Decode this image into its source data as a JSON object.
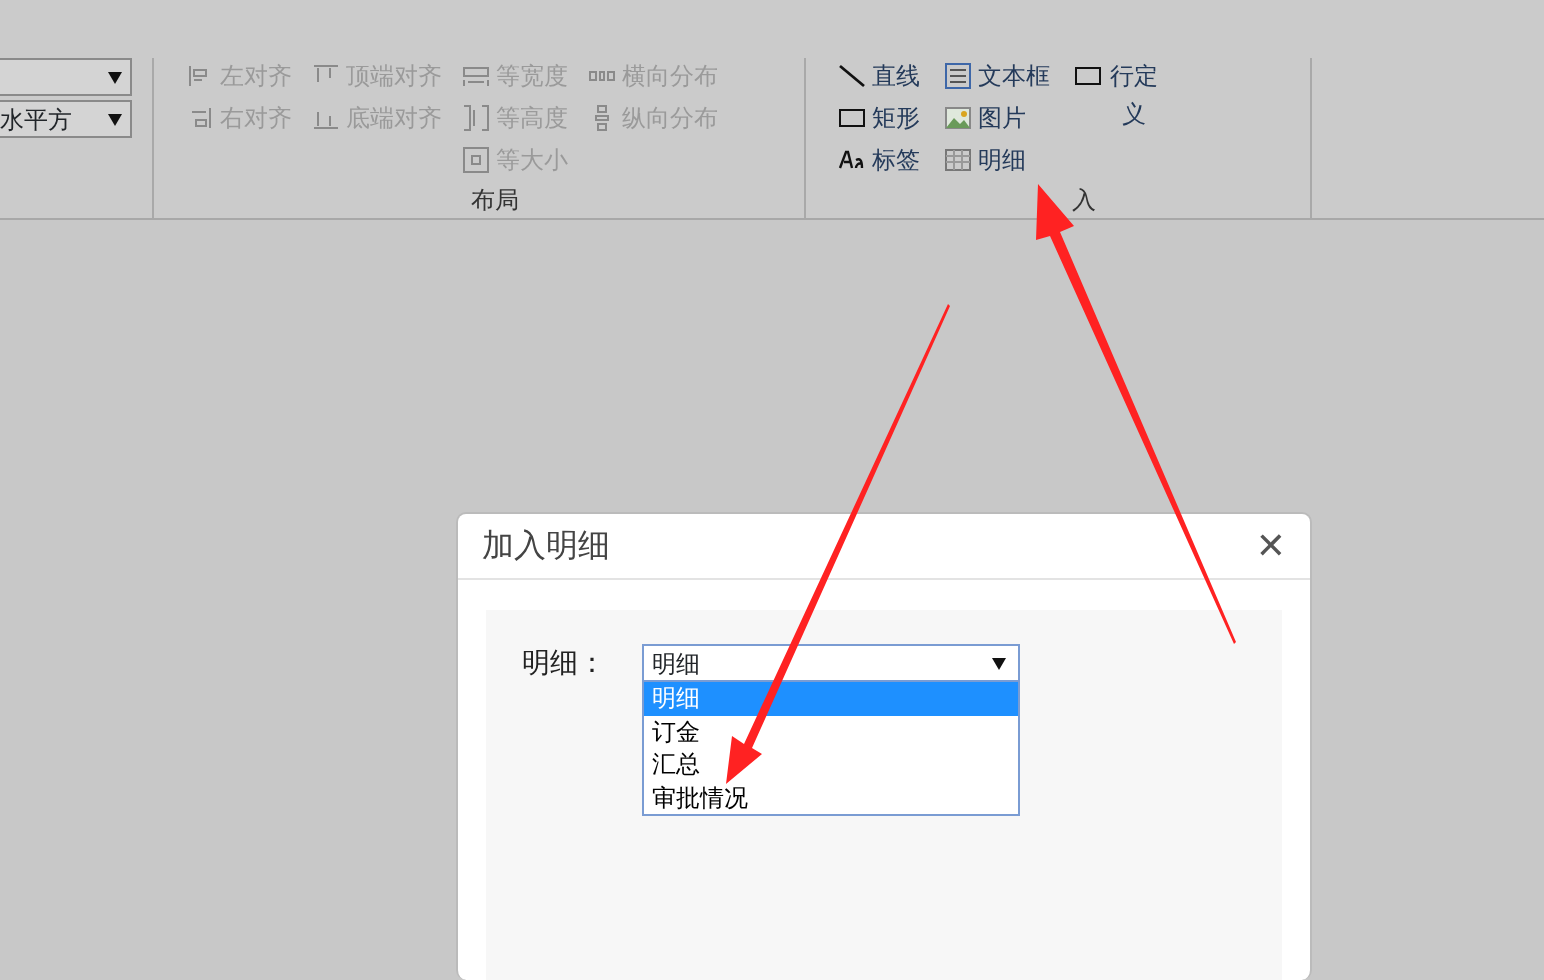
{
  "ribbon": {
    "selects": [
      {
        "kind": "blank"
      },
      {
        "kind": "text",
        "value": "水平方"
      }
    ],
    "groups": [
      {
        "label": "布局",
        "columns": [
          [
            {
              "label": "左对齐",
              "disabled": true
            },
            {
              "label": "右对齐",
              "disabled": true
            }
          ],
          [
            {
              "label": "顶端对齐",
              "disabled": true
            },
            {
              "label": "底端对齐",
              "disabled": true
            }
          ],
          [
            {
              "label": "等宽度",
              "disabled": true
            },
            {
              "label": "等高度",
              "disabled": true
            },
            {
              "label": "等大小",
              "disabled": true
            }
          ],
          [
            {
              "label": "横向分布",
              "disabled": true
            },
            {
              "label": "纵向分布",
              "disabled": true
            }
          ]
        ]
      },
      {
        "label": "入",
        "columns": [
          [
            {
              "label": "直线",
              "disabled": false
            },
            {
              "label": "矩形",
              "disabled": false
            },
            {
              "label": "标签",
              "disabled": false
            }
          ],
          [
            {
              "label": "文本框",
              "disabled": false
            },
            {
              "label": "图片",
              "disabled": false
            },
            {
              "label": "明细",
              "disabled": false
            }
          ],
          [
            {
              "label": "行定义",
              "disabled": false
            }
          ]
        ]
      }
    ]
  },
  "dialog": {
    "title": "加入明细",
    "close": "✕",
    "field_label": "明细：",
    "select_value": "明细",
    "options": [
      {
        "label": "明细",
        "selected": true
      },
      {
        "label": "订金",
        "selected": false
      },
      {
        "label": "汇总",
        "selected": false
      },
      {
        "label": "审批情况",
        "selected": false
      }
    ]
  }
}
